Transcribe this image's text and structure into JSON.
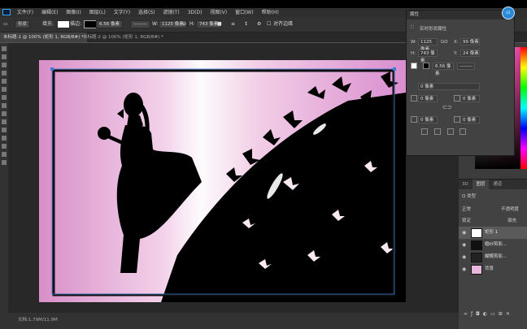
{
  "menu": {
    "items": [
      "文件(F)",
      "编辑(E)",
      "图像(I)",
      "图层(L)",
      "文字(Y)",
      "选择(S)",
      "滤镜(T)",
      "3D(D)",
      "视图(V)",
      "窗口(W)",
      "帮助(H)"
    ]
  },
  "options": {
    "shape_mode": "形状",
    "fill_label": "填充:",
    "stroke_label": "描边:",
    "stroke_width": "6.56 像素",
    "w_label": "W:",
    "w_value": "1125 像素",
    "h_label": "H:",
    "h_value": "743 像素",
    "align_edges": "对齐边缘"
  },
  "tabs": [
    {
      "label": "未标题-1 @ 100% (矩形 1, RGB/8#) *"
    },
    {
      "label": "未标题-2 @ 100% (矩形 1, RGB/8#) *"
    }
  ],
  "properties": {
    "title": "属性",
    "subtitle": "实时形状属性",
    "w_label": "W:",
    "w_value": "1125 像素",
    "go_label": "GO",
    "x_label": "X:",
    "x_value": "99 像素",
    "h_label": "H:",
    "h_value": "743 像素",
    "y_label": "Y:",
    "y_value": "24 像素",
    "stroke_width": "6.56 像素",
    "corner_label": "0 像素",
    "corners": [
      "0 像素",
      "0 像素",
      "0 像素",
      "0 像素"
    ]
  },
  "layers": {
    "tabs": [
      "3D",
      "图层",
      "通道"
    ],
    "filter_label": "Q 类型",
    "mode_label": "正常",
    "opacity_label": "不透明度",
    "lock_label": "锁定",
    "fill_label": "填充",
    "items": [
      {
        "name": "矩形 1"
      },
      {
        "name": "婚纱剪影..."
      },
      {
        "name": "蝴蝶剪影..."
      },
      {
        "name": "背景"
      }
    ]
  },
  "status": {
    "zoom": "文档:1.79M/11.9M"
  },
  "user": {
    "avatar_label": "U1"
  },
  "colors": {
    "accent": "#31a8ff",
    "canvas_pink": "#d88fc8"
  }
}
